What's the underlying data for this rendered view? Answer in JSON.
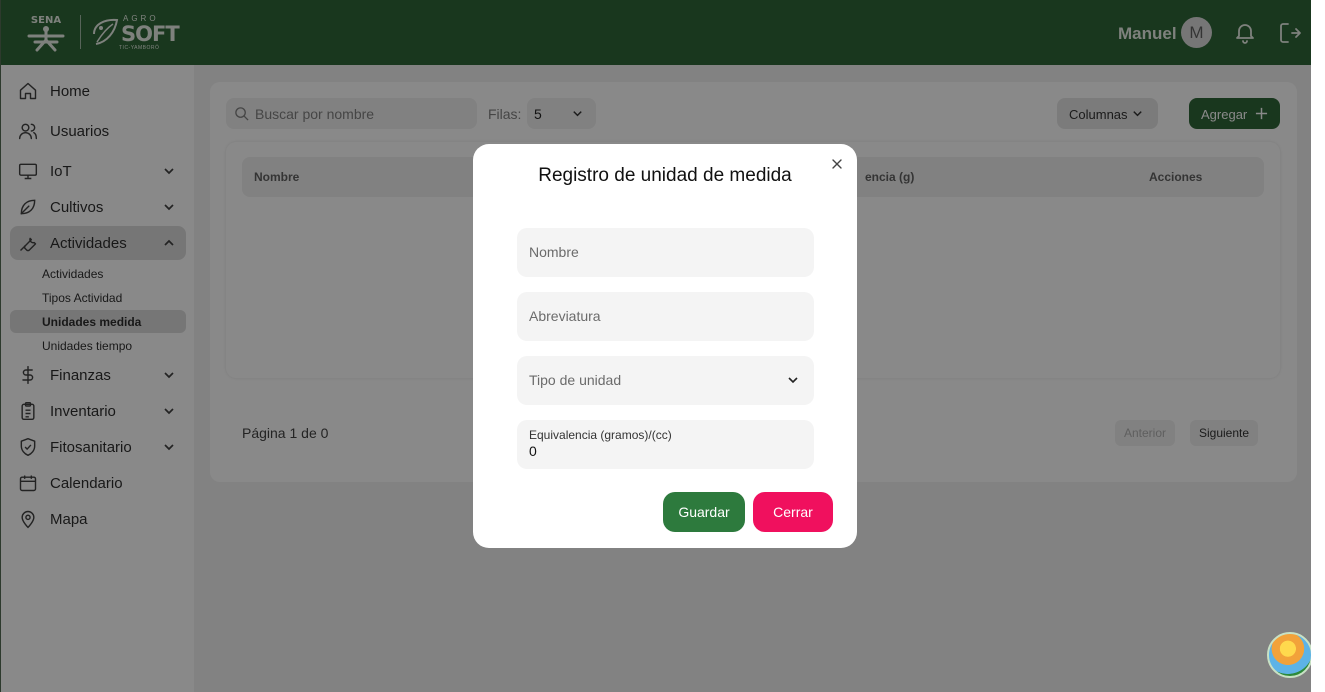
{
  "header": {
    "logo_sena": "SENA",
    "logo_agro_top": "AGRO",
    "logo_agro_main": "SOFT",
    "logo_agro_sub": "TIC-YAMBORÓ",
    "user_name": "Manuel",
    "avatar_initial": "M"
  },
  "sidebar": {
    "items": [
      {
        "label": "Home",
        "icon": "home-icon"
      },
      {
        "label": "Usuarios",
        "icon": "users-icon"
      },
      {
        "label": "IoT",
        "icon": "monitor-icon"
      },
      {
        "label": "Cultivos",
        "icon": "leaf-icon"
      },
      {
        "label": "Actividades",
        "icon": "wrench-icon"
      },
      {
        "label": "Finanzas",
        "icon": "dollar-icon"
      },
      {
        "label": "Inventario",
        "icon": "clipboard-icon"
      },
      {
        "label": "Fitosanitario",
        "icon": "shield-icon"
      },
      {
        "label": "Calendario",
        "icon": "calendar-icon"
      },
      {
        "label": "Mapa",
        "icon": "map-pin-icon"
      }
    ],
    "sub_items": [
      {
        "label": "Actividades"
      },
      {
        "label": "Tipos Actividad"
      },
      {
        "label": "Unidades medida"
      },
      {
        "label": "Unidades tiempo"
      }
    ]
  },
  "toolbar": {
    "search_placeholder": "Buscar por nombre",
    "filas_label": "Filas:",
    "filas_value": "5",
    "columnas_label": "Columnas",
    "agregar_label": "Agregar"
  },
  "table": {
    "columns": [
      "Nombre",
      "encia (g)",
      "Acciones"
    ]
  },
  "pager": {
    "info": "Página 1 de 0",
    "prev": "Anterior",
    "next": "Siguiente"
  },
  "modal": {
    "title": "Registro de unidad de medida",
    "nombre_placeholder": "Nombre",
    "abreviatura_placeholder": "Abreviatura",
    "tipo_placeholder": "Tipo de unidad",
    "equivalencia_label": "Equivalencia (gramos)/(cc)",
    "equivalencia_value": "0",
    "guardar_label": "Guardar",
    "cerrar_label": "Cerrar"
  },
  "colors": {
    "header_green": "#1f5b28",
    "guardar_green": "#2d7a3d",
    "cerrar_pink": "#f0105e"
  }
}
